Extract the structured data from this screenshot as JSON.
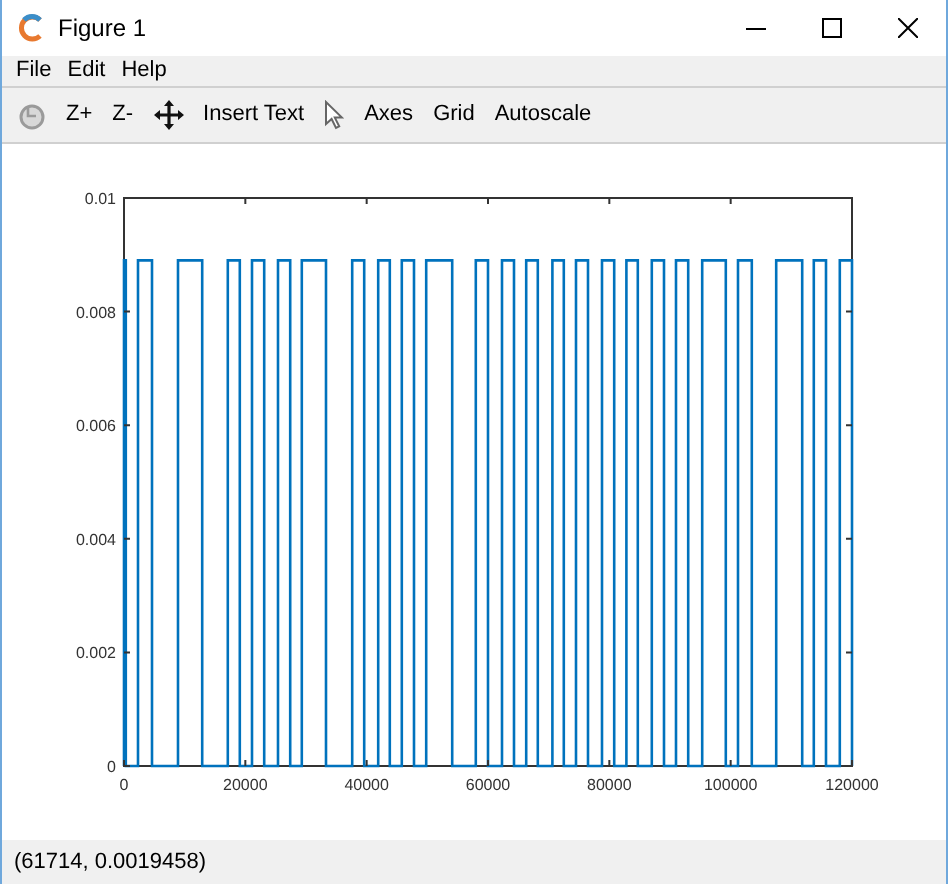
{
  "window": {
    "title": "Figure 1"
  },
  "menu": [
    "File",
    "Edit",
    "Help"
  ],
  "toolbar": [
    "Z+",
    "Z-",
    "Insert Text",
    "Axes",
    "Grid",
    "Autoscale"
  ],
  "chart_data": {
    "type": "line",
    "xlim": [
      0,
      120000
    ],
    "ylim": [
      0,
      0.01
    ],
    "xticks": [
      0,
      20000,
      40000,
      60000,
      80000,
      100000,
      120000
    ],
    "yticks": [
      {
        "value": 0,
        "label": "0"
      },
      {
        "value": 0.002,
        "label": "0.002"
      },
      {
        "value": 0.004,
        "label": "0.004"
      },
      {
        "value": 0.006,
        "label": "0.006"
      },
      {
        "value": 0.008,
        "label": "0.008"
      },
      {
        "value": 0.01,
        "label": "0.01"
      }
    ],
    "x": [
      0,
      0,
      300,
      300,
      2300,
      2300,
      4600,
      4600,
      8900,
      8900,
      12900,
      12900,
      17100,
      17100,
      19100,
      19100,
      21100,
      21100,
      23100,
      23100,
      25400,
      25400,
      27400,
      27400,
      29300,
      29300,
      33300,
      33300,
      37600,
      37600,
      39600,
      39600,
      41900,
      41900,
      43800,
      43800,
      45800,
      45800,
      47800,
      47800,
      49800,
      49800,
      54100,
      54100,
      58000,
      58000,
      60000,
      60000,
      62300,
      62300,
      64300,
      64300,
      66300,
      66300,
      68200,
      68200,
      70600,
      70600,
      72500,
      72500,
      74500,
      74500,
      76500,
      76500,
      78800,
      78800,
      80800,
      80800,
      82800,
      82800,
      84700,
      84700,
      87000,
      87000,
      89000,
      89000,
      91000,
      91000,
      93000,
      93000,
      95300,
      95300,
      99200,
      99200,
      101200,
      101200,
      103500,
      103500,
      107500,
      107500,
      111800,
      111800,
      113700,
      113700,
      115700,
      115700,
      118000,
      118000,
      120000,
      120000
    ],
    "series": [
      {
        "color": "#0072bd",
        "values": [
          0,
          0.0089,
          0.0089,
          0,
          0,
          0.0089,
          0.0089,
          0,
          0,
          0.0089,
          0.0089,
          0,
          0,
          0.0089,
          0.0089,
          0,
          0,
          0.0089,
          0.0089,
          0,
          0,
          0.0089,
          0.0089,
          0,
          0,
          0.0089,
          0.0089,
          0,
          0,
          0.0089,
          0.0089,
          0,
          0,
          0.0089,
          0.0089,
          0,
          0,
          0.0089,
          0.0089,
          0,
          0,
          0.0089,
          0.0089,
          0,
          0,
          0.0089,
          0.0089,
          0,
          0,
          0.0089,
          0.0089,
          0,
          0,
          0.0089,
          0.0089,
          0,
          0,
          0.0089,
          0.0089,
          0,
          0,
          0.0089,
          0.0089,
          0,
          0,
          0.0089,
          0.0089,
          0,
          0,
          0.0089,
          0.0089,
          0,
          0,
          0.0089,
          0.0089,
          0,
          0,
          0.0089,
          0.0089,
          0,
          0,
          0.0089,
          0.0089,
          0,
          0,
          0.0089,
          0.0089,
          0,
          0,
          0.0089,
          0.0089,
          0,
          0,
          0.0089,
          0.0089,
          0,
          0,
          0.0089,
          0.0089,
          0
        ]
      }
    ]
  },
  "status_bar": "(61714, 0.0019458)"
}
